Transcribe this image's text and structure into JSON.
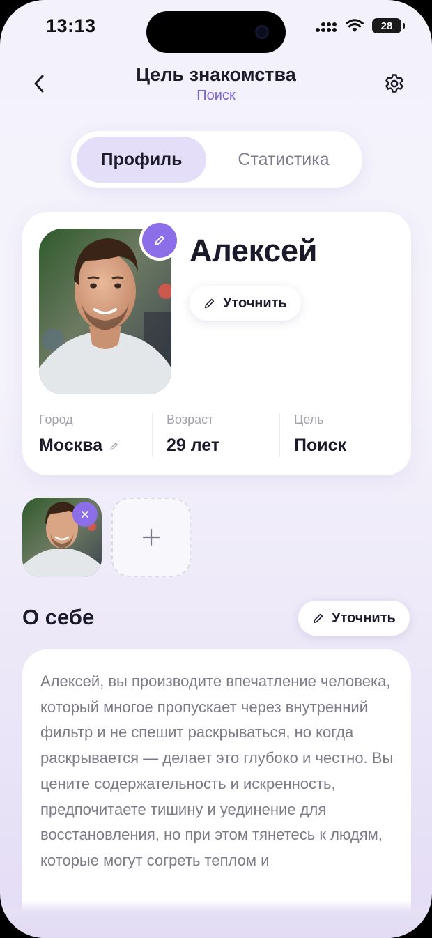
{
  "status_bar": {
    "time": "13:13",
    "battery": "28"
  },
  "header": {
    "title": "Цель знакомства",
    "subtitle": "Поиск"
  },
  "tabs": [
    {
      "label": "Профиль",
      "active": true
    },
    {
      "label": "Статистика",
      "active": false
    }
  ],
  "profile": {
    "name": "Алексей",
    "refine_label": "Уточнить",
    "stats": [
      {
        "label": "Город",
        "value": "Москва",
        "editable": true
      },
      {
        "label": "Возраст",
        "value": "29 лет"
      },
      {
        "label": "Цель",
        "value": "Поиск"
      }
    ]
  },
  "about": {
    "title": "О себе",
    "refine_label": "Уточнить",
    "text": "Алексей, вы производите впечатление человека, который многое пропускает через внутренний фильтр и не спешит раскрываться, но когда раскрывается — делает это глубоко и честно. Вы цените содержательность и искренность, предпочитаете тишину и уединение для восстановления, но при этом тянетесь к людям, которые могут согреть теплом и"
  },
  "colors": {
    "accent": "#8b6ee8",
    "accent_text": "#7a62d8",
    "active_tab_bg": "#e4def8"
  },
  "icons": [
    "back-icon",
    "settings-icon",
    "pencil-icon",
    "close-icon",
    "plus-icon",
    "signal-icon",
    "wifi-icon"
  ]
}
